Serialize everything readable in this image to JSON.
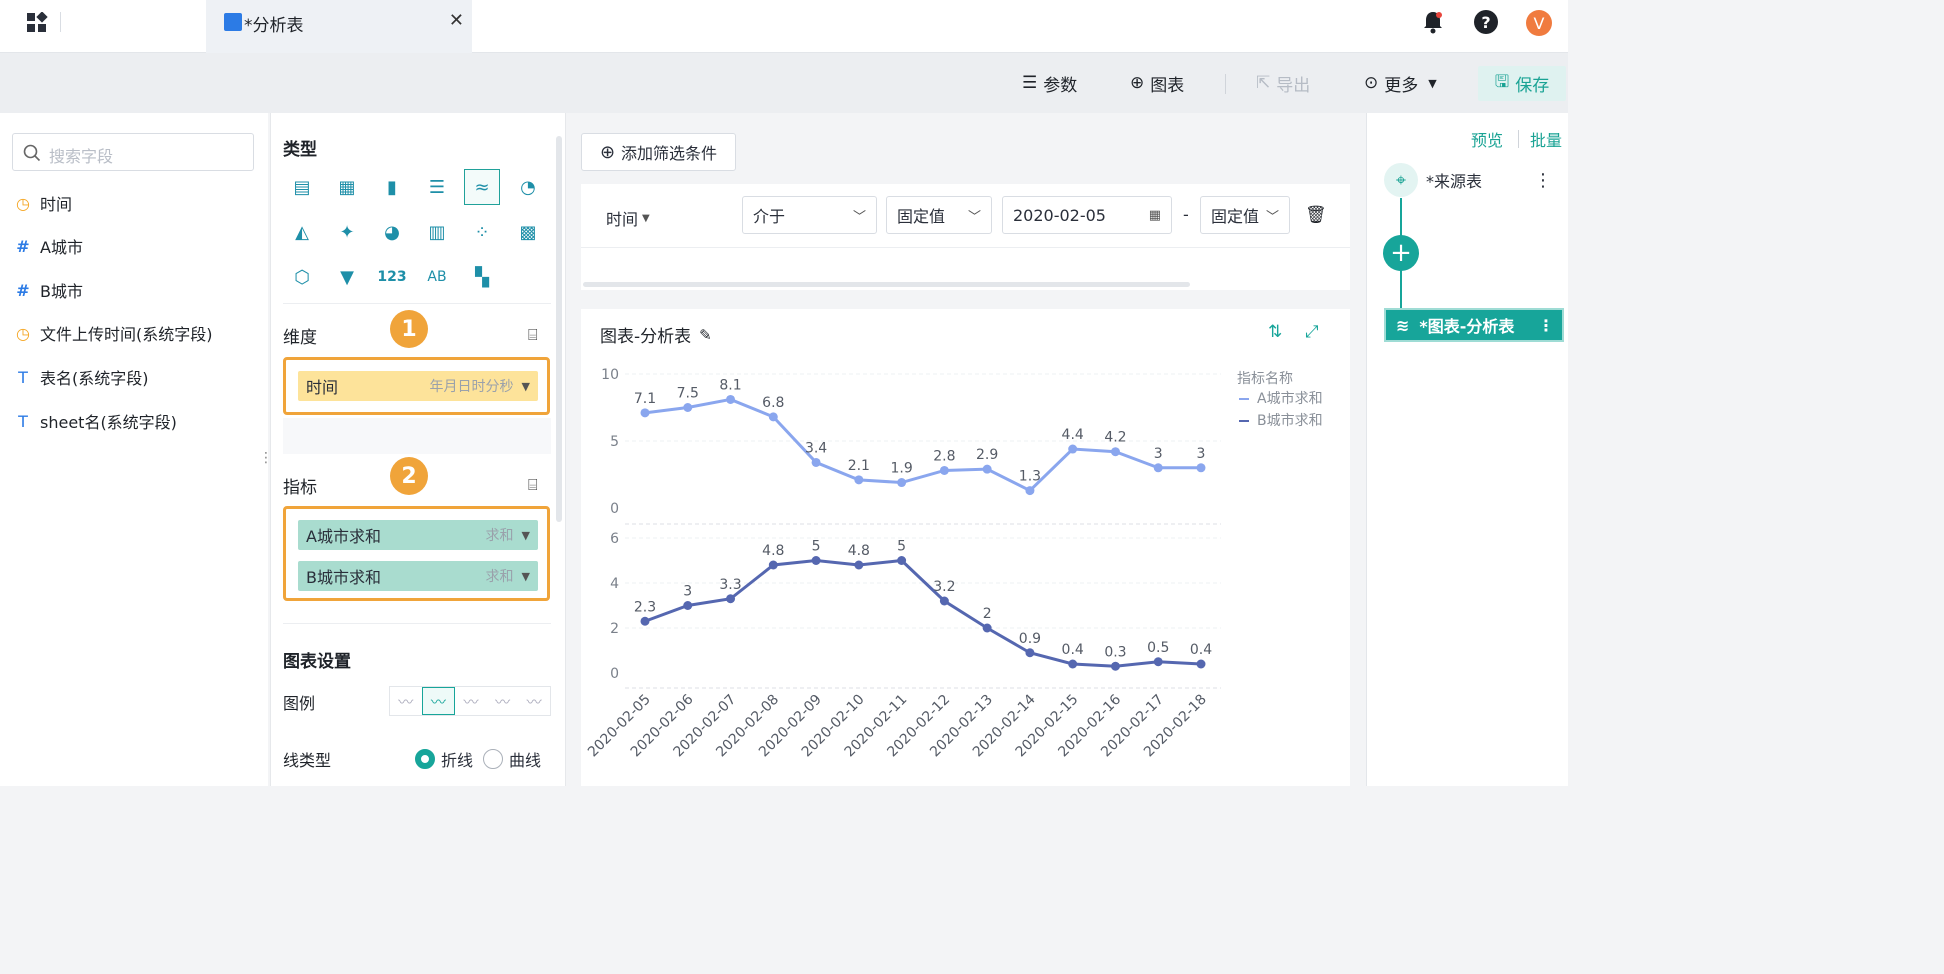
{
  "topbar": {
    "tab_title": "*分析表",
    "close_glyph": "✕",
    "user_initial": "V"
  },
  "toolbar": {
    "params_label": "参数",
    "chart_label": "图表",
    "export_label": "导出",
    "more_label": "更多",
    "save_label": "保存"
  },
  "fields": {
    "search_placeholder": "搜索字段",
    "items": [
      {
        "label": "时间",
        "type": "datetime"
      },
      {
        "label": "A城市",
        "type": "number"
      },
      {
        "label": "B城市",
        "type": "number"
      },
      {
        "label": "文件上传时间(系统字段)",
        "type": "datetime"
      },
      {
        "label": "表名(系统字段)",
        "type": "text"
      },
      {
        "label": "sheet名(系统字段)",
        "type": "text"
      }
    ]
  },
  "config": {
    "type_title": "类型",
    "dimension_title": "维度",
    "dimension_badge": "1",
    "dimension_pill": {
      "label": "时间",
      "agg": "年月日时分秒"
    },
    "metric_title": "指标",
    "metric_badge": "2",
    "metric_pills": [
      {
        "label": "A城市求和",
        "agg": "求和"
      },
      {
        "label": "B城市求和",
        "agg": "求和"
      }
    ],
    "settings_title": "图表设置",
    "legend_label": "图例",
    "linetype_label": "线类型",
    "linetype_options": [
      "折线",
      "曲线"
    ],
    "linetype_selected": "折线",
    "colors": {
      "accent": "#17a59a",
      "highlight": "#f0a43a"
    }
  },
  "filter": {
    "add_label": "添加筛选条件",
    "field": "时间",
    "operator": "介于",
    "mode1": "固定值",
    "date1": "2020-02-05",
    "separator": "-",
    "mode2": "固定值"
  },
  "chart": {
    "title": "图表-分析表"
  },
  "chart_data": {
    "type": "line",
    "legend_title": "指标名称",
    "legend_position": "top-right",
    "categories": [
      "2020-02-05",
      "2020-02-06",
      "2020-02-07",
      "2020-02-08",
      "2020-02-09",
      "2020-02-10",
      "2020-02-11",
      "2020-02-12",
      "2020-02-13",
      "2020-02-14",
      "2020-02-15",
      "2020-02-16",
      "2020-02-17",
      "2020-02-18"
    ],
    "series": [
      {
        "name": "A城市求和",
        "color": "#8aa6ee",
        "values": [
          7.1,
          7.5,
          8.1,
          6.8,
          3.4,
          2.1,
          1.9,
          2.8,
          2.9,
          1.3,
          4.4,
          4.2,
          3,
          3
        ],
        "yticks": [
          0,
          5,
          10
        ],
        "ylim": [
          0,
          10
        ]
      },
      {
        "name": "B城市求和",
        "color": "#5567b0",
        "values": [
          2.3,
          3,
          3.3,
          4.8,
          5,
          4.8,
          5,
          3.2,
          2,
          0.9,
          0.4,
          0.3,
          0.5,
          0.4
        ],
        "yticks": [
          0,
          2,
          4,
          6
        ],
        "ylim": [
          0,
          6
        ]
      }
    ],
    "grid": true
  },
  "right": {
    "preview_label": "预览",
    "batch_label": "批量",
    "source_node": "*来源表",
    "chart_node": "*图表-分析表"
  }
}
